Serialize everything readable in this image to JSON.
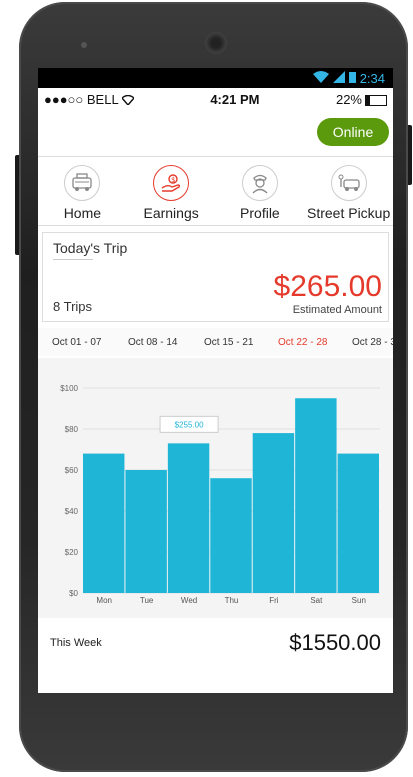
{
  "android_status": {
    "time": "2:34"
  },
  "ios_status": {
    "carrier": "●●●○○ BELL",
    "time": "4:21 PM",
    "battery": "22%"
  },
  "header": {
    "online_label": "Online"
  },
  "nav": [
    {
      "label": "Home",
      "icon": "taxi-icon"
    },
    {
      "label": "Earnings",
      "icon": "money-hand-icon"
    },
    {
      "label": "Profile",
      "icon": "driver-icon"
    },
    {
      "label": "Street Pickup",
      "icon": "street-pickup-icon"
    }
  ],
  "today": {
    "title": "Today's Trip",
    "trips": "8 Trips",
    "amount": "$265.00",
    "amount_label": "Estimated Amount"
  },
  "weeks": {
    "items": [
      "Oct 01 - 07",
      "Oct 08 - 14",
      "Oct 15 - 21",
      "Oct 22 - 28",
      "Oct 28 - 3"
    ],
    "selected_index": 3
  },
  "chart_data": {
    "type": "bar",
    "categories": [
      "Mon",
      "Tue",
      "Wed",
      "Thu",
      "Fri",
      "Sat",
      "Sun"
    ],
    "values": [
      68,
      60,
      73,
      56,
      78,
      95,
      68
    ],
    "ylim": [
      0,
      100
    ],
    "yticks": [
      "$0",
      "$20",
      "$40",
      "$60",
      "$80",
      "$100"
    ],
    "tooltip": {
      "category": "Wed",
      "label": "$255.00"
    },
    "bar_color": "#1fb5d6"
  },
  "week_total": {
    "label": "This Week",
    "value": "$1550.00"
  },
  "colors": {
    "accent": "#e53a2b",
    "online": "#5a9a0c"
  }
}
